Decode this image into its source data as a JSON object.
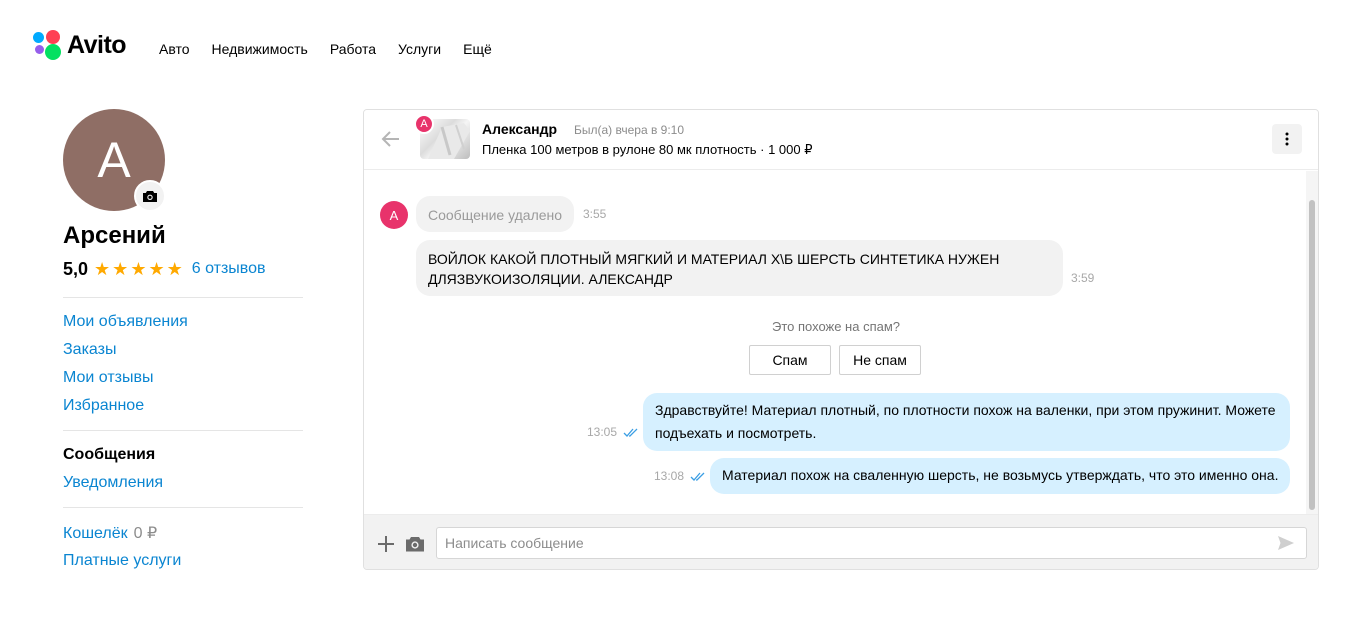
{
  "header": {
    "brand": "Avito",
    "nav": [
      "Авто",
      "Недвижимость",
      "Работа",
      "Услуги",
      "Ещё"
    ]
  },
  "profile": {
    "avatar_letter": "А",
    "name": "Арсений",
    "rating": "5,0",
    "stars": 5,
    "reviews": "6 отзывов",
    "links_group1": [
      "Мои объявления",
      "Заказы",
      "Мои отзывы",
      "Избранное"
    ],
    "messages_label": "Сообщения",
    "notifications_label": "Уведомления",
    "wallet_label": "Кошелёк",
    "wallet_amount": "0 ₽",
    "paid_services_label": "Платные услуги"
  },
  "chat": {
    "badge_letter": "А",
    "user_name": "Александр",
    "status": "Был(а) вчера в 9:10",
    "item": "Пленка 100 метров в рулоне 80 мк плотность · 1 000 ₽",
    "messages": [
      {
        "direction": "in",
        "text": "Сообщение удалено",
        "time": "3:55",
        "deleted": true
      },
      {
        "direction": "in",
        "text": "ВОЙЛОК КАКОЙ ПЛОТНЫЙ МЯГКИЙ И МАТЕРИАЛ Х\\Б ШЕРСТЬ СИНТЕТИКА НУЖЕН ДЛЯЗВУКОИЗОЛЯЦИИ. АЛЕКСАНДР",
        "time": "3:59"
      },
      {
        "direction": "out",
        "text": "Здравствуйте! Материал плотный, по плотности похож на валенки, при этом пружинит. Можете подъехать и посмотреть.",
        "time": "13:05"
      },
      {
        "direction": "out",
        "text": "Материал похож на сваленную шерсть, не возьмусь утверждать, что это именно она.",
        "time": "13:08"
      }
    ],
    "spam_question": "Это похоже на спам?",
    "spam_button": "Спам",
    "not_spam_button": "Не спам",
    "input_placeholder": "Написать сообщение",
    "incoming_avatar_letter": "А"
  },
  "colors": {
    "link": "#0a85d1",
    "star": "#ffa900",
    "outgoing_bubble": "#d6f0ff",
    "incoming_bubble": "#f2f2f2",
    "avatar_bg": "#8f6e65",
    "badge": "#e8336b"
  }
}
